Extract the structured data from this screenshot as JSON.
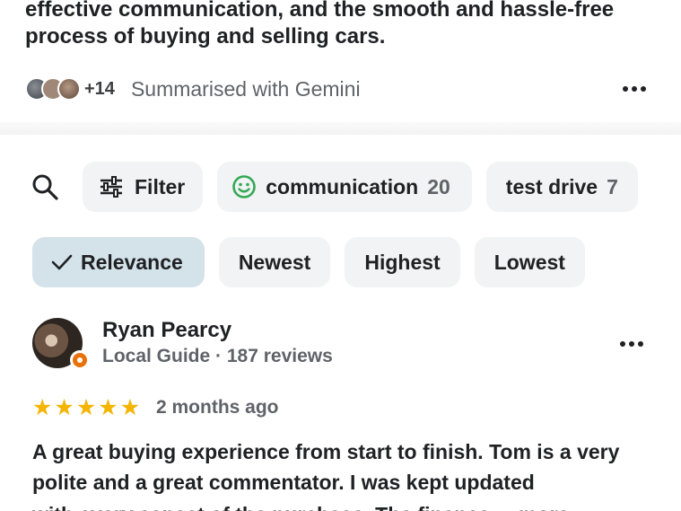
{
  "summary": {
    "text": "effective communication, and the smooth and hassle-free process of buying and selling cars.",
    "contributors_more": "+14",
    "attribution": "Summarised with Gemini"
  },
  "filters": {
    "filter_label": "Filter",
    "topics": [
      {
        "label": "communication",
        "count": "20",
        "icon": "smiley-icon"
      },
      {
        "label": "test drive",
        "count": "7"
      }
    ]
  },
  "sort": {
    "options": [
      "Relevance",
      "Newest",
      "Highest",
      "Lowest"
    ],
    "selected": "Relevance"
  },
  "review": {
    "author": "Ryan Pearcy",
    "meta": "Local Guide · 187 reviews",
    "rating": 5,
    "date": "2 months ago",
    "text": "A great buying experience from start to finish. Tom is a very polite and a great commentator. I was kept updated",
    "text_cut": "with every aspect of the purchase. The finance ... more"
  },
  "colors": {
    "star": "#f4b400",
    "selected_chip": "#d3e3e9",
    "chip": "#f1f3f4",
    "smiley": "#34a853",
    "local_guide_badge": "#e8710a"
  }
}
